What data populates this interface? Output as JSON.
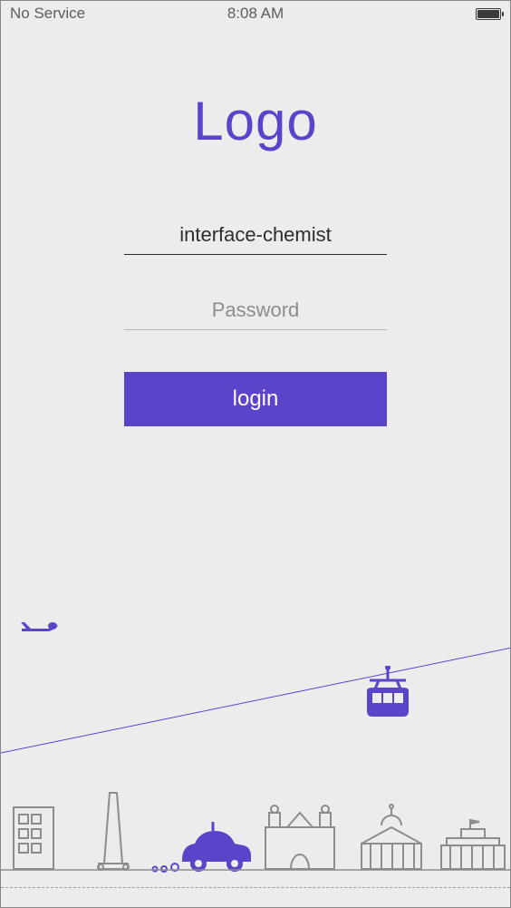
{
  "statusbar": {
    "carrier": "No Service",
    "time": "8:08 AM"
  },
  "logo": {
    "text": "Logo"
  },
  "form": {
    "username_value": "interface-chemist",
    "password_placeholder": "Password",
    "login_label": "login"
  },
  "theme": {
    "accent": "#5b44c9",
    "muted": "#8d8d8d"
  },
  "illustration": {
    "plane": "plane-icon",
    "cablecar": "cablecar-icon",
    "car": "car-icon",
    "buildings": [
      "office-building",
      "monument",
      "fort-building",
      "capitol-building",
      "government-building"
    ]
  }
}
